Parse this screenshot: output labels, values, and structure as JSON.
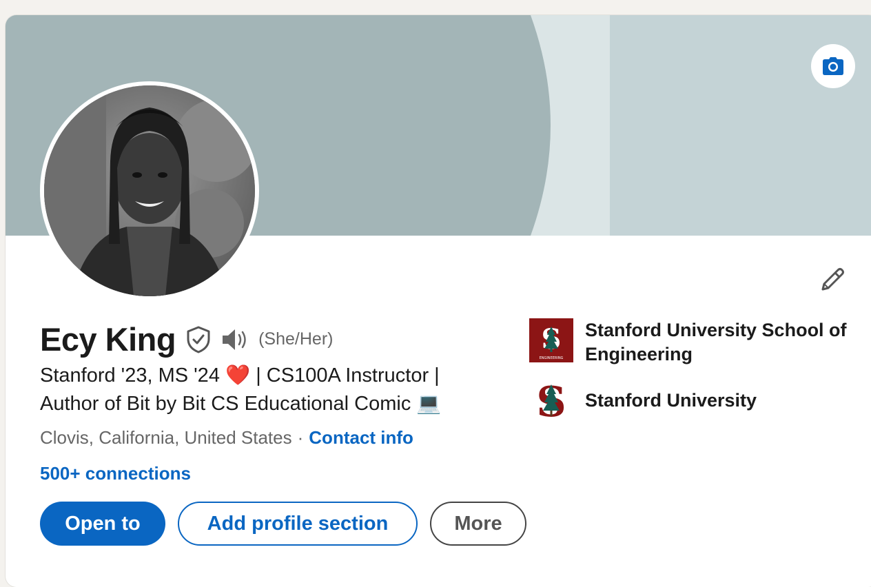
{
  "profile": {
    "name": "Ecy King",
    "pronouns": "(She/Her)",
    "headline_line1": "Stanford '23, MS '24",
    "heart": "❤️",
    "headline_line1_rest": "| CS100A Instructor |",
    "headline_line2": "Author of Bit by Bit CS Educational Comic",
    "laptop": "💻",
    "location": "Clovis, California, United States",
    "separator": "·",
    "contact_info": "Contact info",
    "connections": "500+ connections"
  },
  "actions": {
    "open_to": "Open to",
    "add_section": "Add profile section",
    "more": "More"
  },
  "education": [
    {
      "name": "Stanford University School of Engineering",
      "logo": "stanford-engineering-logo",
      "logo_caption": "ENGINEERING"
    },
    {
      "name": "Stanford University",
      "logo": "stanford-university-logo"
    }
  ],
  "icons": {
    "camera": "camera-icon",
    "edit": "pencil-icon",
    "verify": "shield-check-icon",
    "pronunciation": "speaker-icon"
  },
  "colors": {
    "link_blue": "#0a66c2",
    "banner_dark": "#a3b5b7",
    "banner_light": "#c4d3d6",
    "stanford_red": "#8c1515"
  }
}
